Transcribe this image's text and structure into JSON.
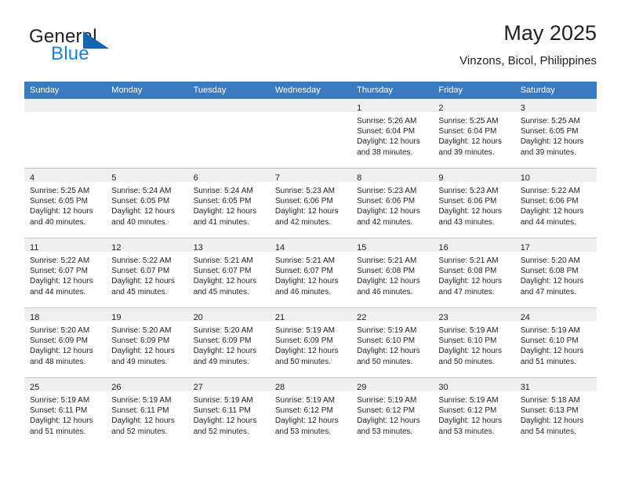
{
  "brand": {
    "name_top": "General",
    "name_bottom": "Blue",
    "accent_color": "#1566b0",
    "text_color": "#1f7fd4",
    "triangle_icon": "triangle-icon"
  },
  "header": {
    "title": "May 2025",
    "subtitle": "Vinzons, Bicol, Philippines"
  },
  "calendar": {
    "header_bg": "#3a7bbf",
    "daynum_bg": "#f0f0f0",
    "grid_line": "#c8c8c8",
    "weekdays": [
      "Sunday",
      "Monday",
      "Tuesday",
      "Wednesday",
      "Thursday",
      "Friday",
      "Saturday"
    ],
    "weeks": [
      [
        {
          "empty": true
        },
        {
          "empty": true
        },
        {
          "empty": true
        },
        {
          "empty": true
        },
        {
          "day": "1",
          "sunrise": "Sunrise: 5:26 AM",
          "sunset": "Sunset: 6:04 PM",
          "daylight1": "Daylight: 12 hours",
          "daylight2": "and 38 minutes."
        },
        {
          "day": "2",
          "sunrise": "Sunrise: 5:25 AM",
          "sunset": "Sunset: 6:04 PM",
          "daylight1": "Daylight: 12 hours",
          "daylight2": "and 39 minutes."
        },
        {
          "day": "3",
          "sunrise": "Sunrise: 5:25 AM",
          "sunset": "Sunset: 6:05 PM",
          "daylight1": "Daylight: 12 hours",
          "daylight2": "and 39 minutes."
        }
      ],
      [
        {
          "day": "4",
          "sunrise": "Sunrise: 5:25 AM",
          "sunset": "Sunset: 6:05 PM",
          "daylight1": "Daylight: 12 hours",
          "daylight2": "and 40 minutes."
        },
        {
          "day": "5",
          "sunrise": "Sunrise: 5:24 AM",
          "sunset": "Sunset: 6:05 PM",
          "daylight1": "Daylight: 12 hours",
          "daylight2": "and 40 minutes."
        },
        {
          "day": "6",
          "sunrise": "Sunrise: 5:24 AM",
          "sunset": "Sunset: 6:05 PM",
          "daylight1": "Daylight: 12 hours",
          "daylight2": "and 41 minutes."
        },
        {
          "day": "7",
          "sunrise": "Sunrise: 5:23 AM",
          "sunset": "Sunset: 6:06 PM",
          "daylight1": "Daylight: 12 hours",
          "daylight2": "and 42 minutes."
        },
        {
          "day": "8",
          "sunrise": "Sunrise: 5:23 AM",
          "sunset": "Sunset: 6:06 PM",
          "daylight1": "Daylight: 12 hours",
          "daylight2": "and 42 minutes."
        },
        {
          "day": "9",
          "sunrise": "Sunrise: 5:23 AM",
          "sunset": "Sunset: 6:06 PM",
          "daylight1": "Daylight: 12 hours",
          "daylight2": "and 43 minutes."
        },
        {
          "day": "10",
          "sunrise": "Sunrise: 5:22 AM",
          "sunset": "Sunset: 6:06 PM",
          "daylight1": "Daylight: 12 hours",
          "daylight2": "and 44 minutes."
        }
      ],
      [
        {
          "day": "11",
          "sunrise": "Sunrise: 5:22 AM",
          "sunset": "Sunset: 6:07 PM",
          "daylight1": "Daylight: 12 hours",
          "daylight2": "and 44 minutes."
        },
        {
          "day": "12",
          "sunrise": "Sunrise: 5:22 AM",
          "sunset": "Sunset: 6:07 PM",
          "daylight1": "Daylight: 12 hours",
          "daylight2": "and 45 minutes."
        },
        {
          "day": "13",
          "sunrise": "Sunrise: 5:21 AM",
          "sunset": "Sunset: 6:07 PM",
          "daylight1": "Daylight: 12 hours",
          "daylight2": "and 45 minutes."
        },
        {
          "day": "14",
          "sunrise": "Sunrise: 5:21 AM",
          "sunset": "Sunset: 6:07 PM",
          "daylight1": "Daylight: 12 hours",
          "daylight2": "and 46 minutes."
        },
        {
          "day": "15",
          "sunrise": "Sunrise: 5:21 AM",
          "sunset": "Sunset: 6:08 PM",
          "daylight1": "Daylight: 12 hours",
          "daylight2": "and 46 minutes."
        },
        {
          "day": "16",
          "sunrise": "Sunrise: 5:21 AM",
          "sunset": "Sunset: 6:08 PM",
          "daylight1": "Daylight: 12 hours",
          "daylight2": "and 47 minutes."
        },
        {
          "day": "17",
          "sunrise": "Sunrise: 5:20 AM",
          "sunset": "Sunset: 6:08 PM",
          "daylight1": "Daylight: 12 hours",
          "daylight2": "and 47 minutes."
        }
      ],
      [
        {
          "day": "18",
          "sunrise": "Sunrise: 5:20 AM",
          "sunset": "Sunset: 6:09 PM",
          "daylight1": "Daylight: 12 hours",
          "daylight2": "and 48 minutes."
        },
        {
          "day": "19",
          "sunrise": "Sunrise: 5:20 AM",
          "sunset": "Sunset: 6:09 PM",
          "daylight1": "Daylight: 12 hours",
          "daylight2": "and 49 minutes."
        },
        {
          "day": "20",
          "sunrise": "Sunrise: 5:20 AM",
          "sunset": "Sunset: 6:09 PM",
          "daylight1": "Daylight: 12 hours",
          "daylight2": "and 49 minutes."
        },
        {
          "day": "21",
          "sunrise": "Sunrise: 5:19 AM",
          "sunset": "Sunset: 6:09 PM",
          "daylight1": "Daylight: 12 hours",
          "daylight2": "and 50 minutes."
        },
        {
          "day": "22",
          "sunrise": "Sunrise: 5:19 AM",
          "sunset": "Sunset: 6:10 PM",
          "daylight1": "Daylight: 12 hours",
          "daylight2": "and 50 minutes."
        },
        {
          "day": "23",
          "sunrise": "Sunrise: 5:19 AM",
          "sunset": "Sunset: 6:10 PM",
          "daylight1": "Daylight: 12 hours",
          "daylight2": "and 50 minutes."
        },
        {
          "day": "24",
          "sunrise": "Sunrise: 5:19 AM",
          "sunset": "Sunset: 6:10 PM",
          "daylight1": "Daylight: 12 hours",
          "daylight2": "and 51 minutes."
        }
      ],
      [
        {
          "day": "25",
          "sunrise": "Sunrise: 5:19 AM",
          "sunset": "Sunset: 6:11 PM",
          "daylight1": "Daylight: 12 hours",
          "daylight2": "and 51 minutes."
        },
        {
          "day": "26",
          "sunrise": "Sunrise: 5:19 AM",
          "sunset": "Sunset: 6:11 PM",
          "daylight1": "Daylight: 12 hours",
          "daylight2": "and 52 minutes."
        },
        {
          "day": "27",
          "sunrise": "Sunrise: 5:19 AM",
          "sunset": "Sunset: 6:11 PM",
          "daylight1": "Daylight: 12 hours",
          "daylight2": "and 52 minutes."
        },
        {
          "day": "28",
          "sunrise": "Sunrise: 5:19 AM",
          "sunset": "Sunset: 6:12 PM",
          "daylight1": "Daylight: 12 hours",
          "daylight2": "and 53 minutes."
        },
        {
          "day": "29",
          "sunrise": "Sunrise: 5:19 AM",
          "sunset": "Sunset: 6:12 PM",
          "daylight1": "Daylight: 12 hours",
          "daylight2": "and 53 minutes."
        },
        {
          "day": "30",
          "sunrise": "Sunrise: 5:19 AM",
          "sunset": "Sunset: 6:12 PM",
          "daylight1": "Daylight: 12 hours",
          "daylight2": "and 53 minutes."
        },
        {
          "day": "31",
          "sunrise": "Sunrise: 5:18 AM",
          "sunset": "Sunset: 6:13 PM",
          "daylight1": "Daylight: 12 hours",
          "daylight2": "and 54 minutes."
        }
      ]
    ]
  }
}
